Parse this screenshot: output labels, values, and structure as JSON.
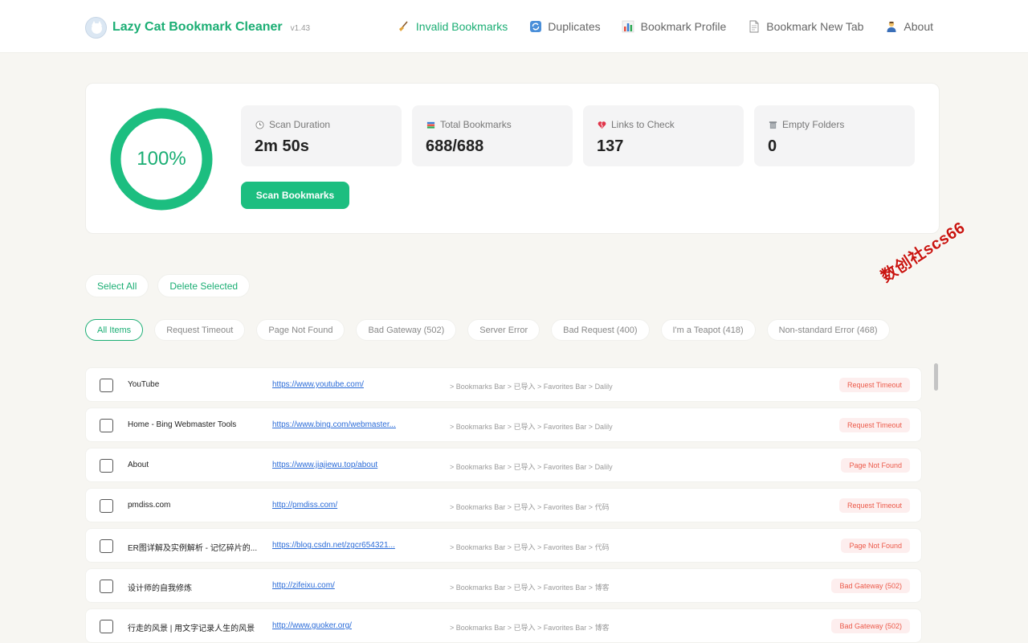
{
  "header": {
    "brand_title": "Lazy Cat Bookmark Cleaner",
    "version": "v1.43",
    "nav": [
      {
        "label": "Invalid Bookmarks",
        "icon": "broom-icon",
        "active": true
      },
      {
        "label": "Duplicates",
        "icon": "refresh-icon",
        "active": false
      },
      {
        "label": "Bookmark Profile",
        "icon": "bar-chart-icon",
        "active": false
      },
      {
        "label": "Bookmark New Tab",
        "icon": "page-icon",
        "active": false
      },
      {
        "label": "About",
        "icon": "person-icon",
        "active": false
      }
    ]
  },
  "summary": {
    "progress_label": "100%",
    "progress_value": 1.0,
    "stats": [
      {
        "label": "Scan Duration",
        "value": "2m 50s",
        "icon": "clock-icon"
      },
      {
        "label": "Total Bookmarks",
        "value": "688/688",
        "icon": "books-icon"
      },
      {
        "label": "Links to Check",
        "value": "137",
        "icon": "broken-heart-icon"
      },
      {
        "label": "Empty Folders",
        "value": "0",
        "icon": "trash-icon"
      }
    ],
    "scan_button": "Scan Bookmarks"
  },
  "actions": {
    "select_all": "Select All",
    "delete_selected": "Delete Selected"
  },
  "filters": [
    {
      "label": "All Items",
      "active": true
    },
    {
      "label": "Request Timeout",
      "active": false
    },
    {
      "label": "Page Not Found",
      "active": false
    },
    {
      "label": "Bad Gateway (502)",
      "active": false
    },
    {
      "label": "Server Error",
      "active": false
    },
    {
      "label": "Bad Request (400)",
      "active": false
    },
    {
      "label": "I'm a Teapot (418)",
      "active": false
    },
    {
      "label": "Non-standard Error (468)",
      "active": false
    }
  ],
  "watermark": "数创社scs66",
  "bookmarks": [
    {
      "title": "YouTube",
      "url": "https://www.youtube.com/",
      "path": "> Bookmarks Bar > 已导入 > Favorites Bar > Dalily",
      "status": "Request Timeout"
    },
    {
      "title": "Home - Bing Webmaster Tools",
      "url": "https://www.bing.com/webmaster...",
      "path": "> Bookmarks Bar > 已导入 > Favorites Bar > Dalily",
      "status": "Request Timeout"
    },
    {
      "title": "About",
      "url": "https://www.jiajiewu.top/about",
      "path": "> Bookmarks Bar > 已导入 > Favorites Bar > Dalily",
      "status": "Page Not Found"
    },
    {
      "title": "pmdiss.com",
      "url": "http://pmdiss.com/",
      "path": "> Bookmarks Bar > 已导入 > Favorites Bar > 代码",
      "status": "Request Timeout"
    },
    {
      "title": "ER图详解及实例解析 - 记忆碎片的...",
      "url": "https://blog.csdn.net/zgcr654321...",
      "path": "> Bookmarks Bar > 已导入 > Favorites Bar > 代码",
      "status": "Page Not Found"
    },
    {
      "title": "设计师的自我修炼",
      "url": "http://zifeixu.com/",
      "path": "> Bookmarks Bar > 已导入 > Favorites Bar > 博客",
      "status": "Bad Gateway (502)"
    },
    {
      "title": "行走的风景 | 用文字记录人生的风景",
      "url": "http://www.guoker.org/",
      "path": "> Bookmarks Bar > 已导入 > Favorites Bar > 博客",
      "status": "Bad Gateway (502)"
    }
  ],
  "colors": {
    "accent": "#1bae74",
    "button": "#1cbe80",
    "badge_bg": "#fdeeee",
    "badge_text": "#ec5a4a",
    "link": "#2a6bd8"
  }
}
